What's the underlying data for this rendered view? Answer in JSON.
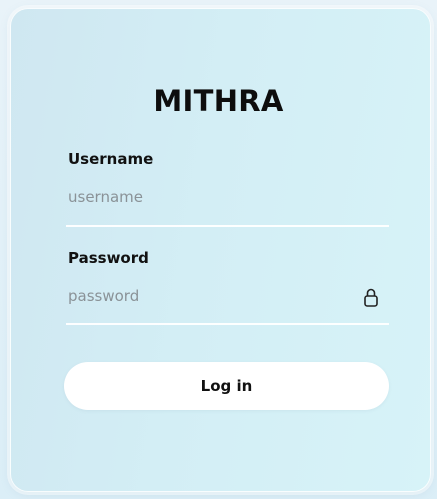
{
  "login_form": {
    "title": "MITHRA",
    "username": {
      "label": "Username",
      "placeholder": "username",
      "value": ""
    },
    "password": {
      "label": "Password",
      "placeholder": "password",
      "value": "",
      "icon": "lock-icon"
    },
    "submit_label": "Log in"
  },
  "colors": {
    "card_background": "#d3eef5",
    "button_background": "#ffffff",
    "text_primary": "#111111",
    "placeholder_text": "#8a9297"
  }
}
